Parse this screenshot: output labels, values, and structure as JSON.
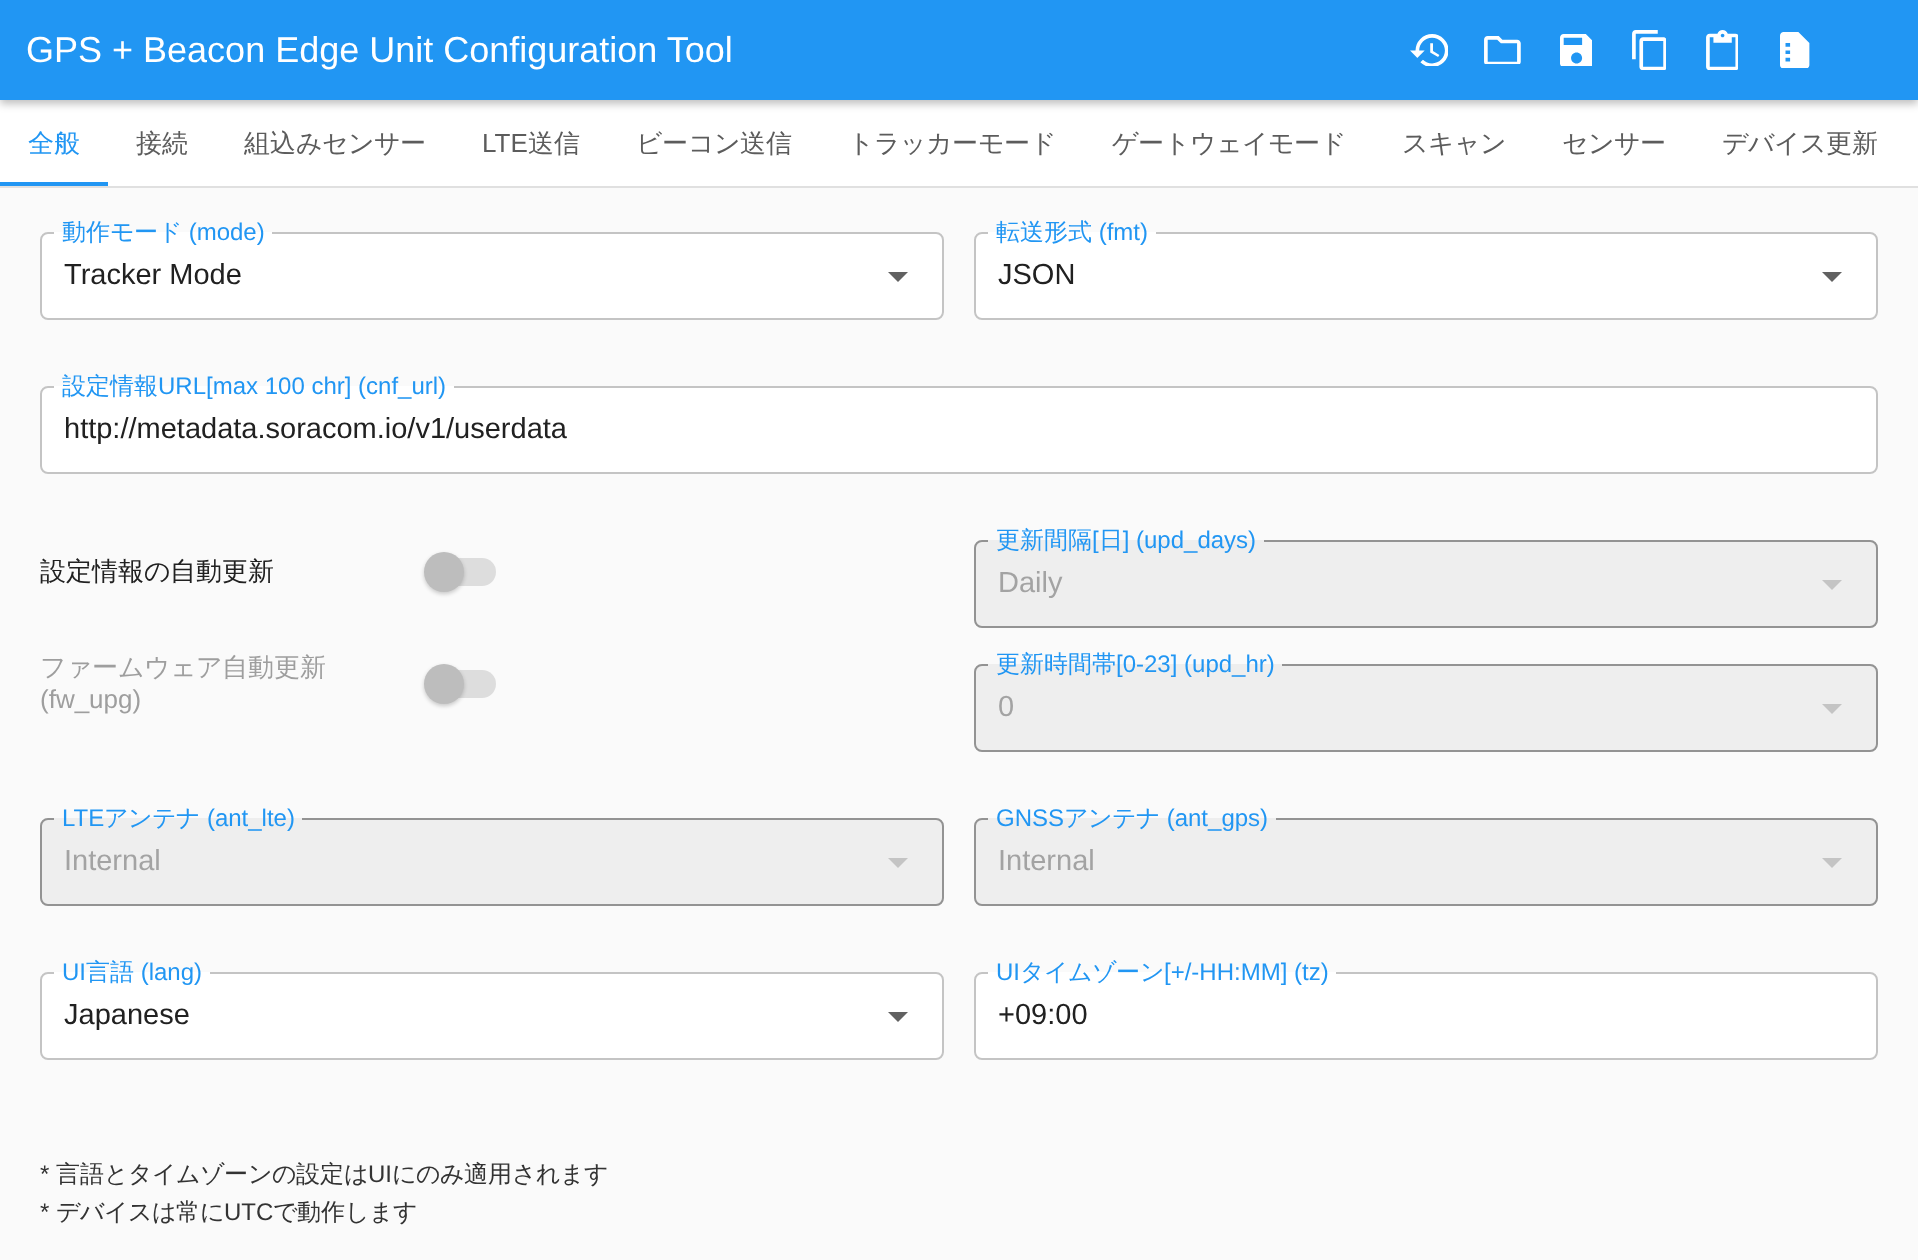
{
  "app_bar": {
    "title": "GPS + Beacon Edge Unit Configuration Tool"
  },
  "tabs": [
    {
      "label": "全般",
      "selected": true
    },
    {
      "label": "接続",
      "selected": false
    },
    {
      "label": "組込みセンサー",
      "selected": false
    },
    {
      "label": "LTE送信",
      "selected": false
    },
    {
      "label": "ビーコン送信",
      "selected": false
    },
    {
      "label": "トラッカーモード",
      "selected": false
    },
    {
      "label": "ゲートウェイモード",
      "selected": false
    },
    {
      "label": "スキャン",
      "selected": false
    },
    {
      "label": "センサー",
      "selected": false
    },
    {
      "label": "デバイス更新",
      "selected": false
    }
  ],
  "rows": [
    {
      "items": [
        {
          "kind": "select",
          "label": "動作モード (mode)",
          "value": "Tracker Mode",
          "disabled": false
        },
        {
          "kind": "select",
          "label": "転送形式 (fmt)",
          "value": "JSON",
          "disabled": false
        }
      ]
    },
    {
      "items": [
        {
          "kind": "text",
          "label": "設定情報URL[max 100 chr] (cnf_url)",
          "value": "http://metadata.soracom.io/v1/userdata",
          "disabled": false
        }
      ]
    },
    {
      "items": [
        {
          "kind": "toggle",
          "label": "設定情報の自動更新",
          "on": false,
          "disabled": false
        },
        {
          "kind": "select",
          "label": "更新間隔[日] (upd_days)",
          "value": "Daily",
          "disabled": true
        }
      ]
    },
    {
      "items": [
        {
          "kind": "toggle",
          "label": "ファームウェア自動更新 (fw_upg)",
          "on": false,
          "disabled": true
        },
        {
          "kind": "select",
          "label": "更新時間帯[0-23] (upd_hr)",
          "value": "0",
          "disabled": true
        }
      ]
    },
    {
      "items": [
        {
          "kind": "select",
          "label": "LTEアンテナ (ant_lte)",
          "value": "Internal",
          "disabled": true
        },
        {
          "kind": "select",
          "label": "GNSSアンテナ (ant_gps)",
          "value": "Internal",
          "disabled": true
        }
      ]
    },
    {
      "items": [
        {
          "kind": "select",
          "label": "UI言語 (lang)",
          "value": "Japanese",
          "disabled": false
        },
        {
          "kind": "text",
          "label": "UIタイムゾーン[+/-HH:MM] (tz)",
          "value": "+09:00",
          "disabled": false
        }
      ]
    }
  ],
  "notes": [
    "* 言語とタイムゾーンの設定はUIにのみ適用されます",
    "* デバイスは常にUTCで動作します"
  ]
}
